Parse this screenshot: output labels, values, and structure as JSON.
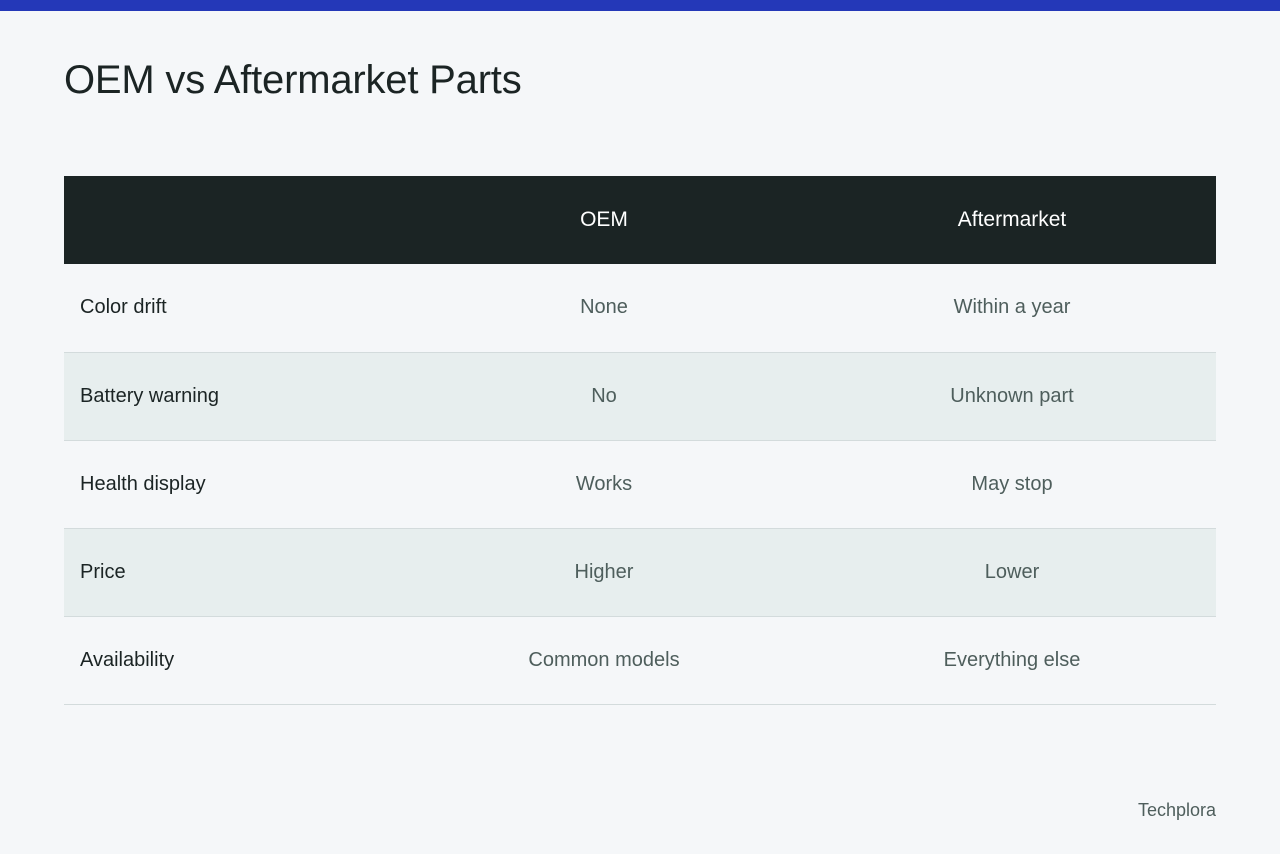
{
  "colors": {
    "accent_bar": "#2438b8",
    "header_bg": "#1b2424",
    "page_bg": "#f5f7f9",
    "stripe_bg": "#e7eeee"
  },
  "page": {
    "title": "OEM vs Aftermarket Parts"
  },
  "table": {
    "columns": [
      "",
      "OEM",
      "Aftermarket"
    ],
    "rows": [
      {
        "label": "Color drift",
        "oem": "None",
        "aftermarket": "Within a year"
      },
      {
        "label": "Battery warning",
        "oem": "No",
        "aftermarket": "Unknown part"
      },
      {
        "label": "Health display",
        "oem": "Works",
        "aftermarket": "May stop"
      },
      {
        "label": "Price",
        "oem": "Higher",
        "aftermarket": "Lower"
      },
      {
        "label": "Availability",
        "oem": "Common models",
        "aftermarket": "Everything else"
      }
    ]
  },
  "footer": {
    "brand": "Techplora"
  }
}
